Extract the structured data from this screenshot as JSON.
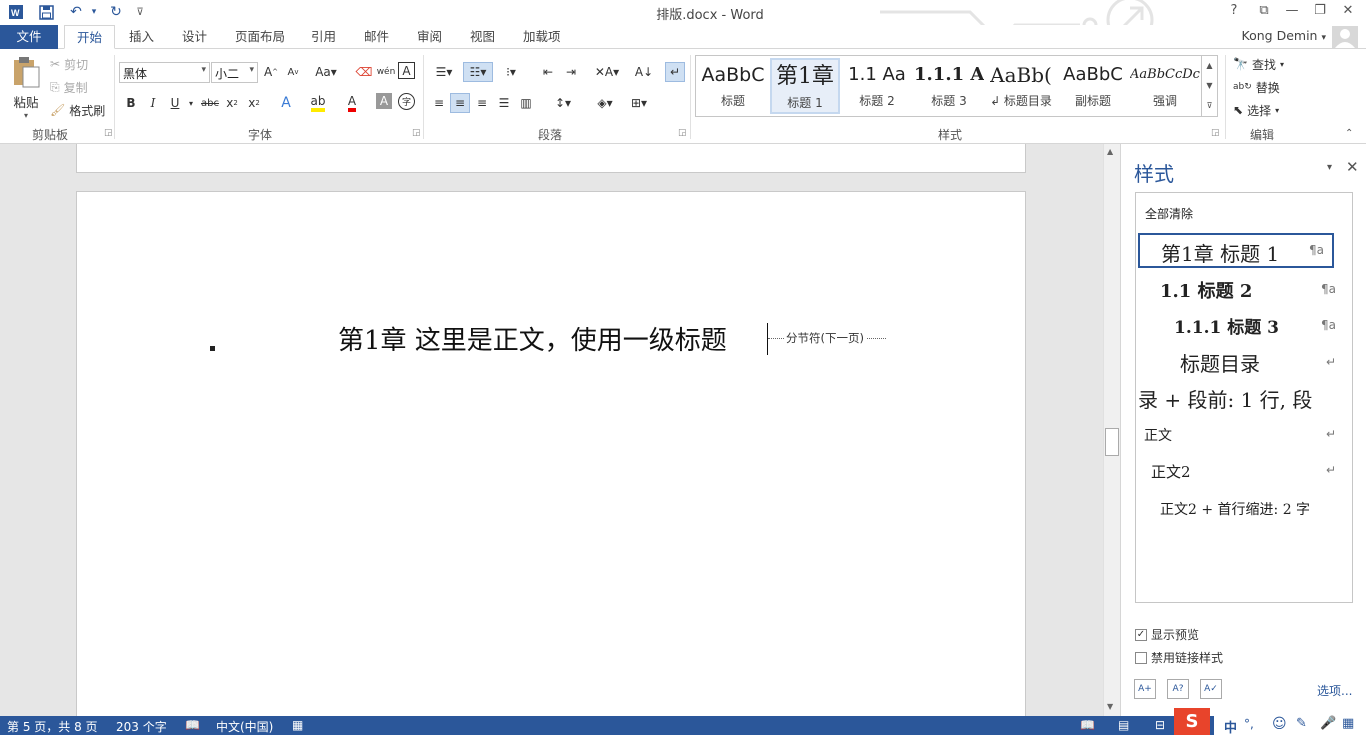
{
  "window": {
    "title": "排版.docx - Word",
    "help": "?",
    "restore_ribbon": "⧉",
    "minimize": "—",
    "maximize": "❐",
    "close": "✕"
  },
  "quick_access": {
    "customize": "⊽"
  },
  "tabs": [
    {
      "label": "文件"
    },
    {
      "label": "开始"
    },
    {
      "label": "插入"
    },
    {
      "label": "设计"
    },
    {
      "label": "页面布局"
    },
    {
      "label": "引用"
    },
    {
      "label": "邮件"
    },
    {
      "label": "审阅"
    },
    {
      "label": "视图"
    },
    {
      "label": "加载项"
    }
  ],
  "user": {
    "name": "Kong Demin"
  },
  "ribbon": {
    "clipboard": {
      "paste": "粘贴",
      "cut": "剪切",
      "copy": "复制",
      "format_painter": "格式刷",
      "label": "剪贴板"
    },
    "font": {
      "name": "黑体",
      "size": "小二",
      "label": "字体"
    },
    "paragraph": {
      "label": "段落"
    },
    "styles": {
      "label": "样式",
      "items": [
        {
          "preview": "AaBbC",
          "name": "标题"
        },
        {
          "preview": "第1章",
          "name": "标题 1"
        },
        {
          "preview": "1.1  Aa",
          "name": "标题 2"
        },
        {
          "preview": "1.1.1  A",
          "name": "标题 3"
        },
        {
          "preview": "AaBb(",
          "name": "↲ 标题目录"
        },
        {
          "preview": "AaBbC",
          "name": "副标题"
        },
        {
          "preview": "AaBbCcDc",
          "name": "强调"
        }
      ]
    },
    "editing": {
      "find": "查找",
      "replace": "替换",
      "select": "选择",
      "label": "编辑"
    }
  },
  "document": {
    "heading": "第1章  这里是正文，使用一级标题",
    "section_break": "分节符(下一页)"
  },
  "styles_pane": {
    "title": "样式",
    "clear_all": "全部清除",
    "items": [
      {
        "text": "第1章  标题 1",
        "mark": "¶a"
      },
      {
        "text": "1.1  标题 2",
        "mark": "¶a"
      },
      {
        "text": "1.1.1  标题 3",
        "mark": "¶a"
      },
      {
        "text": "标题目录",
        "mark": "↵"
      },
      {
        "text": "录 + 段前: 1 行, 段",
        "mark": ""
      },
      {
        "text": "正文",
        "mark": "↵"
      },
      {
        "text": "正文2",
        "mark": "↵"
      },
      {
        "text": "正文2 + 首行缩进:  2 字",
        "mark": ""
      }
    ],
    "show_preview": "显示预览",
    "show_preview_checked": true,
    "disable_linked": "禁用链接样式",
    "disable_linked_checked": false,
    "options": "选项..."
  },
  "status": {
    "page": "第 5 页，共 8 页",
    "words": "203 个字",
    "language": "中文(中国)",
    "ime": "中"
  },
  "colors": {
    "accent": "#2b579a",
    "ime": "#e8442b"
  }
}
